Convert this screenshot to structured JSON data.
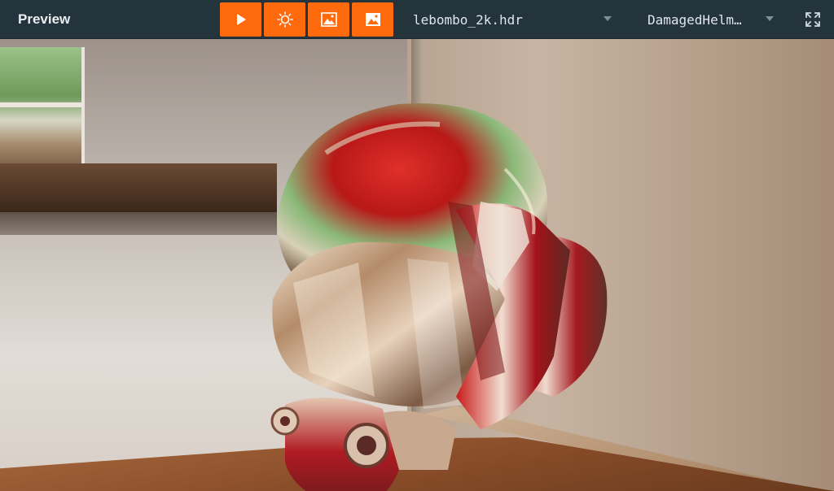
{
  "panel": {
    "title": "Preview"
  },
  "toolbar": {
    "buttons": [
      {
        "name": "play-button",
        "icon": "play-icon"
      },
      {
        "name": "light-button",
        "icon": "sun-icon"
      },
      {
        "name": "background-button",
        "icon": "image-icon"
      },
      {
        "name": "environment-button",
        "icon": "image-filled-icon"
      }
    ],
    "accent_color": "#ff6a0d",
    "environment_select": {
      "value": "lebombo_2k.hdr"
    },
    "model_select": {
      "value": "DamagedHelm…"
    },
    "fullscreen_icon": "fullscreen-icon"
  }
}
